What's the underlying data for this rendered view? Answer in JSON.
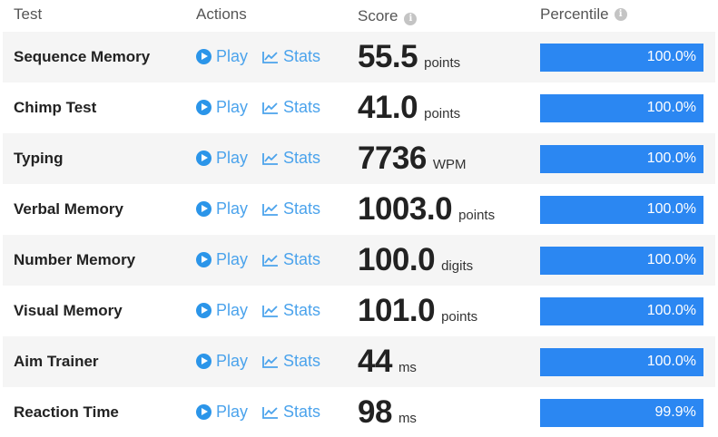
{
  "header": {
    "test": "Test",
    "actions": "Actions",
    "score": "Score",
    "percentile": "Percentile",
    "info_icon": "i"
  },
  "colors": {
    "bar": "#2b87f2",
    "link": "#4ba3ec",
    "row_alt": "#f5f5f5"
  },
  "rows": [
    {
      "test": "Sequence Memory",
      "play": "Play",
      "stats": "Stats",
      "score": "55.5",
      "unit": "points",
      "percentile": "100.0%",
      "fill": 1.0
    },
    {
      "test": "Chimp Test",
      "play": "Play",
      "stats": "Stats",
      "score": "41.0",
      "unit": "points",
      "percentile": "100.0%",
      "fill": 1.0
    },
    {
      "test": "Typing",
      "play": "Play",
      "stats": "Stats",
      "score": "7736",
      "unit": "WPM",
      "percentile": "100.0%",
      "fill": 1.0
    },
    {
      "test": "Verbal Memory",
      "play": "Play",
      "stats": "Stats",
      "score": "1003.0",
      "unit": "points",
      "percentile": "100.0%",
      "fill": 1.0
    },
    {
      "test": "Number Memory",
      "play": "Play",
      "stats": "Stats",
      "score": "100.0",
      "unit": "digits",
      "percentile": "100.0%",
      "fill": 1.0
    },
    {
      "test": "Visual Memory",
      "play": "Play",
      "stats": "Stats",
      "score": "101.0",
      "unit": "points",
      "percentile": "100.0%",
      "fill": 1.0
    },
    {
      "test": "Aim Trainer",
      "play": "Play",
      "stats": "Stats",
      "score": "44",
      "unit": "ms",
      "percentile": "100.0%",
      "fill": 1.0
    },
    {
      "test": "Reaction Time",
      "play": "Play",
      "stats": "Stats",
      "score": "98",
      "unit": "ms",
      "percentile": "99.9%",
      "fill": 0.999
    }
  ]
}
